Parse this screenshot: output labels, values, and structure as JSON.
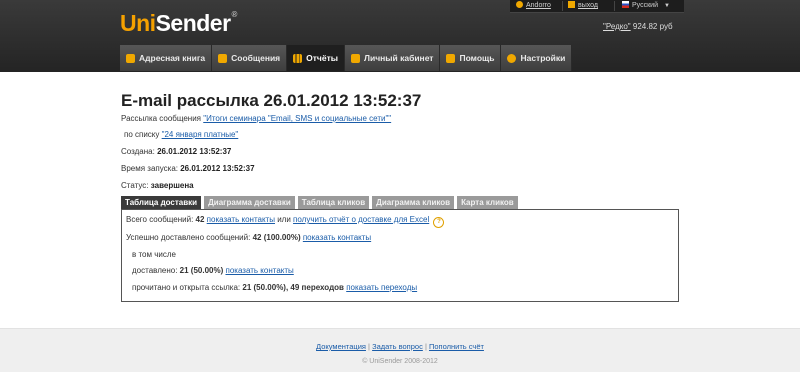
{
  "brand": {
    "part1": "Uni",
    "part2": "Sender",
    "reg": "®"
  },
  "topbar": {
    "user": "Andorro",
    "logout": "выход",
    "language": "Русский"
  },
  "balance": {
    "plan": "\"Редко\"",
    "amount": "924.82 руб"
  },
  "nav": [
    {
      "label": "Адресная книга"
    },
    {
      "label": "Сообщения"
    },
    {
      "label": "Отчёты"
    },
    {
      "label": "Личный кабинет"
    },
    {
      "label": "Помощь"
    },
    {
      "label": "Настройки"
    }
  ],
  "page": {
    "title": "E-mail рассылка 26.01.2012 13:52:37",
    "mailing_label": "Рассылка сообщения",
    "mailing_link": "\"Итоги семинара \"Email, SMS и социальные сети\"\"",
    "list_label": "по списку",
    "list_link": "\"24 января платные\"",
    "created_label": "Создана:",
    "created_value": "26.01.2012 13:52:37",
    "started_label": "Время запуска:",
    "started_value": "26.01.2012 13:52:37",
    "status_label": "Статус:",
    "status_value": "завершена"
  },
  "tabs": [
    {
      "label": "Таблица доставки"
    },
    {
      "label": "Диаграмма доставки"
    },
    {
      "label": "Таблица кликов"
    },
    {
      "label": "Диаграмма кликов"
    },
    {
      "label": "Карта кликов"
    }
  ],
  "report": {
    "total_label": "Всего сообщений:",
    "total_value": "42",
    "show_contacts": "показать контакты",
    "or": "или",
    "excel_link": "получить отчёт о доставке для Excel",
    "delivered_ok_label": "Успешно доставлено сообщений:",
    "delivered_ok_value": "42 (100.00%)",
    "including": "в том числе",
    "delivered_label": "доставлено:",
    "delivered_value": "21 (50.00%)",
    "read_label": "прочитано и открыта ссылка:",
    "read_value": "21 (50.00%), 49 переходов",
    "show_clicks": "показать переходы"
  },
  "footer": {
    "docs": "Документация",
    "ask": "Задать вопрос",
    "topup": "Пополнить счёт",
    "separator": "|",
    "copyright": "© UniSender 2008-2012"
  },
  "colors": {
    "accent": "#f5a100",
    "header": "#2f2f2f",
    "link": "#1a5ca8"
  }
}
